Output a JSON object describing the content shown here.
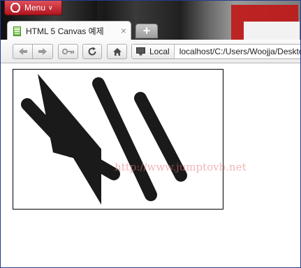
{
  "browser": {
    "menu_label": "Menu",
    "tab_title": "HTML 5 Canvas 예제",
    "tab_close": "×",
    "new_tab": "+",
    "site_label": "Local",
    "url": "localhost/C:/Users/Woojja/Desktop/"
  },
  "page": {
    "watermark": "http://www.jumptovb.net"
  },
  "colors": {
    "opera_red": "#c8141e",
    "stroke": "#1a1a1a"
  }
}
